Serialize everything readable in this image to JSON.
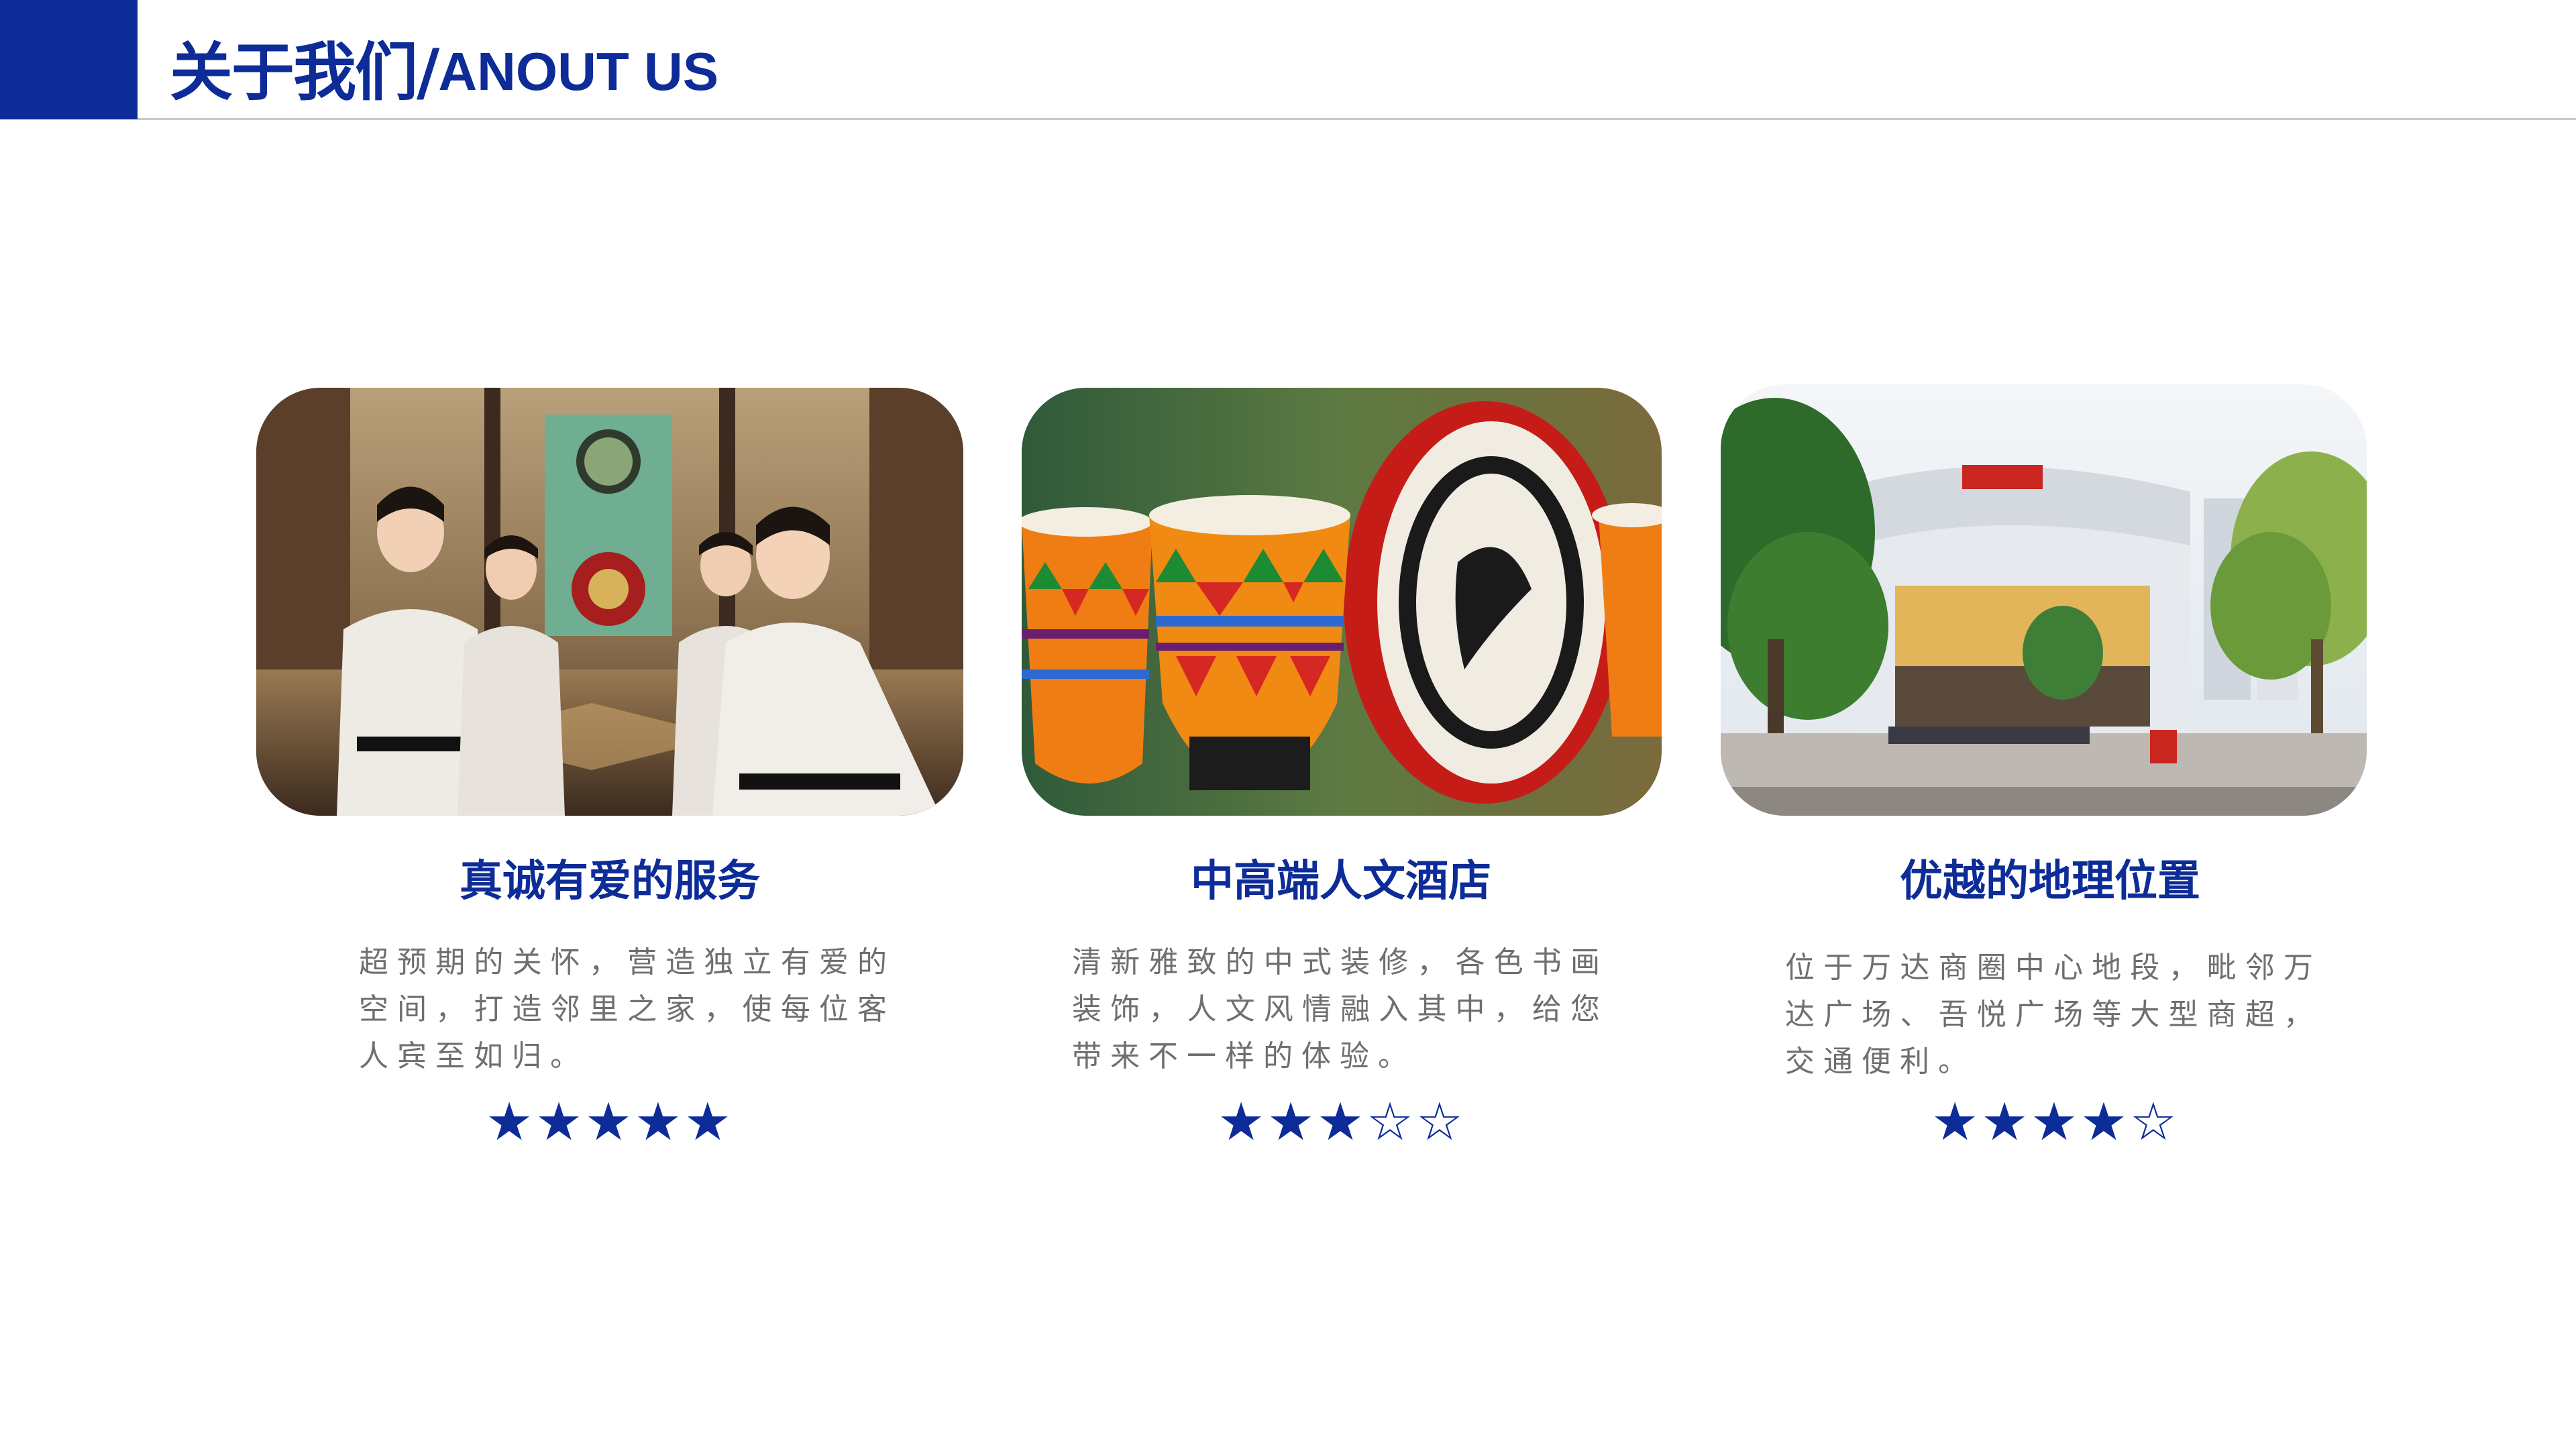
{
  "header": {
    "title_cn": "关于我们/",
    "title_en": "ANOUT US"
  },
  "cards": [
    {
      "title": "真诚有爱的服务",
      "description": "超预期的关怀，营造独立有爱的空间，打造邻里之家，使每位客人宾至如归。",
      "rating": 5,
      "stars": "★★★★★",
      "image": "photo-hotel-staff-welcome"
    },
    {
      "title": "中高端人文酒店",
      "description": "清新雅致的中式装修，各色书画装饰，人文风情融入其中，给您带来不一样的体验。",
      "rating": 3,
      "stars": "★★★☆☆",
      "image": "photo-decorative-drums"
    },
    {
      "title": "优越的地理位置",
      "description": "位于万达商圈中心地段，毗邻万达广场、吾悦广场等大型商超，交通便利。",
      "rating": 4,
      "stars": "★★★★☆",
      "image": "photo-shopping-plaza-street"
    }
  ],
  "colors": {
    "brand_blue": "#0d2c98",
    "body_text": "#6f6f6f",
    "rule": "#c9c9c9"
  }
}
